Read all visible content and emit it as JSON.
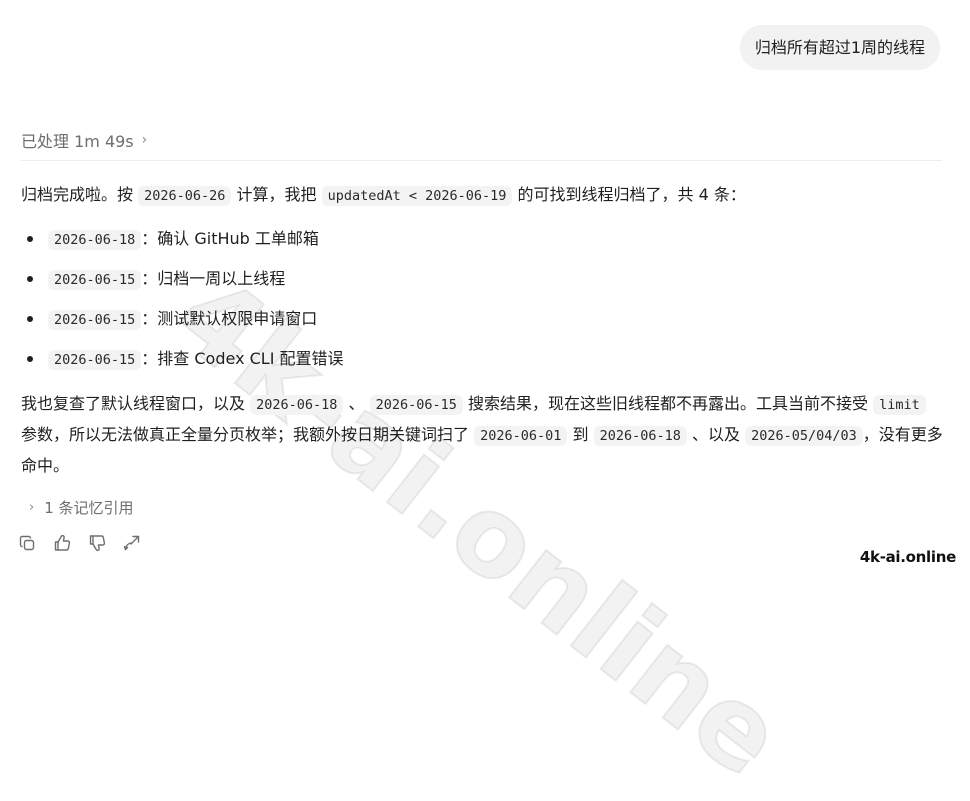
{
  "user_message": "归档所有超过1周的线程",
  "processed": {
    "label": "已处理 1m 49s",
    "chevron": "›"
  },
  "answer": {
    "intro": {
      "t1": "归档完成啦。按",
      "code1": "2026-06-26",
      "t2": "计算，我把",
      "code2": "updatedAt < 2026-06-19",
      "t3": "的可找到线程归档了，共 4 条："
    },
    "items": [
      {
        "date": "2026-06-18",
        "sep": "：",
        "title": "确认 GitHub 工单邮箱"
      },
      {
        "date": "2026-06-15",
        "sep": "：",
        "title": "归档一周以上线程"
      },
      {
        "date": "2026-06-15",
        "sep": "：",
        "title": "测试默认权限申请窗口"
      },
      {
        "date": "2026-06-15",
        "sep": "：",
        "title": "排查 Codex CLI 配置错误"
      }
    ],
    "para2": {
      "t1": "我也复查了默认线程窗口，以及",
      "c1": "2026-06-18",
      "t2": "、",
      "c2": "2026-06-15",
      "t3": "搜索结果，现在这些旧线程都不再露出。工具当前不接受",
      "c3": "limit",
      "t4": "参数，所以无法做真正全量分页枚举；我额外按日期关键词扫了",
      "c4": "2026-06-01",
      "t5": "到",
      "c5": "2026-06-18",
      "t6": "、以及",
      "c6": "2026-05/04/03",
      "t7": "，没有更多命中。"
    }
  },
  "memory": {
    "label": "1 条记忆引用",
    "chevron": "›"
  },
  "actions": {
    "icons": [
      "copy-icon",
      "thumbs-up-icon",
      "thumbs-down-icon",
      "share-icon"
    ],
    "icon_color": "#6e6e6e"
  },
  "watermark": {
    "text": "4k-ai.online"
  },
  "colors": {
    "bubble_bg": "#f2f2f2",
    "code_bg": "#f3f3f3",
    "muted_text": "#6e6e6e",
    "body_text": "#1f1f1f"
  }
}
